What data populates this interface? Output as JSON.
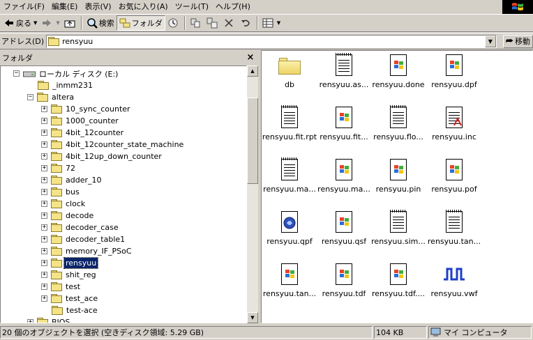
{
  "menu": [
    "ファイル(F)",
    "編集(E)",
    "表示(V)",
    "お気に入り(A)",
    "ツール(T)",
    "ヘルプ(H)"
  ],
  "toolbar": {
    "back_label": "戻る",
    "search_label": "検索",
    "folders_label": "フォルダ"
  },
  "address": {
    "label": "アドレス(D)",
    "value": "rensyuu",
    "go_label": "移動"
  },
  "folder_pane": {
    "title": "フォルダ",
    "close": "×",
    "drive": "ローカル ディスク (E:)",
    "items": [
      {
        "label": "_inmm231",
        "expander": "",
        "level": 1
      },
      {
        "label": "altera",
        "expander": "−",
        "level": 1
      },
      {
        "label": "10_sync_counter",
        "expander": "+",
        "level": 2
      },
      {
        "label": "1000_counter",
        "expander": "+",
        "level": 2
      },
      {
        "label": "4bit_12counter",
        "expander": "+",
        "level": 2
      },
      {
        "label": "4bit_12counter_state_machine",
        "expander": "+",
        "level": 2
      },
      {
        "label": "4bit_12up_down_counter",
        "expander": "+",
        "level": 2
      },
      {
        "label": "72",
        "expander": "+",
        "level": 2
      },
      {
        "label": "adder_10",
        "expander": "+",
        "level": 2
      },
      {
        "label": "bus",
        "expander": "+",
        "level": 2
      },
      {
        "label": "clock",
        "expander": "+",
        "level": 2
      },
      {
        "label": "decode",
        "expander": "+",
        "level": 2
      },
      {
        "label": "decoder_case",
        "expander": "+",
        "level": 2
      },
      {
        "label": "decoder_table1",
        "expander": "+",
        "level": 2
      },
      {
        "label": "memory_IF_PSoC",
        "expander": "+",
        "level": 2
      },
      {
        "label": "rensyuu",
        "expander": "+",
        "level": 2,
        "selected": true
      },
      {
        "label": "shit_reg",
        "expander": "+",
        "level": 2
      },
      {
        "label": "test",
        "expander": "+",
        "level": 2
      },
      {
        "label": "test_ace",
        "expander": "+",
        "level": 2
      },
      {
        "label": "test-ace",
        "expander": "",
        "level": 2
      },
      {
        "label": "BIOS",
        "expander": "+",
        "level": 1
      }
    ]
  },
  "files": [
    {
      "name": "db",
      "icon": "folder"
    },
    {
      "name": "rensyuu.as...",
      "icon": "text-doc"
    },
    {
      "name": "rensyuu.done",
      "icon": "windows-doc"
    },
    {
      "name": "rensyuu.dpf",
      "icon": "windows-doc"
    },
    {
      "name": "rensyuu.fit.rpt",
      "icon": "text-doc"
    },
    {
      "name": "rensyuu.fit...",
      "icon": "windows-doc"
    },
    {
      "name": "rensyuu.flo...",
      "icon": "text-doc"
    },
    {
      "name": "rensyuu.inc",
      "icon": "text-doc-red"
    },
    {
      "name": "rensyuu.ma...",
      "icon": "text-doc"
    },
    {
      "name": "rensyuu.ma...",
      "icon": "windows-doc"
    },
    {
      "name": "rensyuu.pin",
      "icon": "windows-doc"
    },
    {
      "name": "rensyuu.pof",
      "icon": "windows-doc"
    },
    {
      "name": "rensyuu.qpf",
      "icon": "quartus-doc"
    },
    {
      "name": "rensyuu.qsf",
      "icon": "windows-doc"
    },
    {
      "name": "rensyuu.sim...",
      "icon": "text-doc"
    },
    {
      "name": "rensyuu.tan...",
      "icon": "text-doc"
    },
    {
      "name": "rensyuu.tan...",
      "icon": "windows-doc"
    },
    {
      "name": "rensyuu.tdf",
      "icon": "windows-doc"
    },
    {
      "name": "rensyuu.tdf....",
      "icon": "windows-doc"
    },
    {
      "name": "rensyuu.vwf",
      "icon": "waveform"
    }
  ],
  "status": {
    "selection": "20 個のオブジェクトを選択 (空きディスク領域: 5.29 GB)",
    "size": "104 KB",
    "location": "マイ コンピュータ"
  }
}
